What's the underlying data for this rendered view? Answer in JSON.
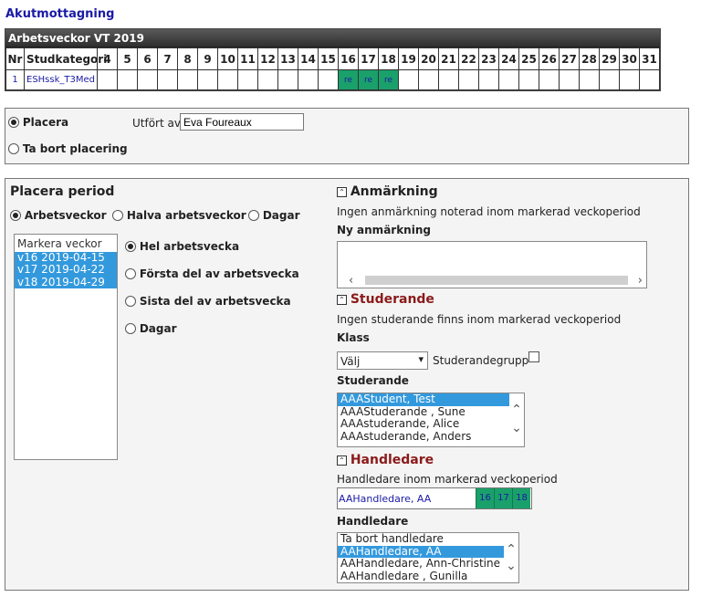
{
  "page": {
    "title": "Akutmottagning"
  },
  "weeks": {
    "header": "Arbetsveckor VT 2019",
    "col_nr": "Nr",
    "col_kat": "Studkategori",
    "week_numbers": [
      "4",
      "5",
      "6",
      "7",
      "8",
      "9",
      "10",
      "11",
      "12",
      "13",
      "14",
      "15",
      "16",
      "17",
      "18",
      "19",
      "20",
      "21",
      "22",
      "23",
      "24",
      "25",
      "26",
      "27",
      "28",
      "29",
      "30",
      "31"
    ],
    "row": {
      "nr": "1",
      "kat": "ESHssk_T3Med",
      "placed_weeks": [
        "16",
        "17",
        "18"
      ],
      "placed_label": "re"
    }
  },
  "placera": {
    "option_placera": "Placera",
    "option_ta_bort": "Ta bort placering",
    "utfort_label": "Utfört av",
    "utfort_value": "Eva Foureaux"
  },
  "period": {
    "title": "Placera period",
    "opt_arbetsveckor": "Arbetsveckor",
    "opt_halva": "Halva arbetsveckor",
    "opt_dagar": "Dagar",
    "markera_label": "Markera veckor",
    "weeks_list": [
      "v16 2019-04-15",
      "v17 2019-04-22",
      "v18 2019-04-29"
    ],
    "sub_hel": "Hel arbetsvecka",
    "sub_forsta": "Första del av arbetsvecka",
    "sub_sista": "Sista del av arbetsvecka",
    "sub_dagar": "Dagar"
  },
  "anmarkning": {
    "title": "Anmärkning",
    "info": "Ingen anmärkning noterad inom markerad veckoperiod",
    "new_label": "Ny anmärkning",
    "value": ""
  },
  "studerande": {
    "title": "Studerande",
    "info": "Ingen studerande finns inom markerad veckoperiod",
    "klass_label": "Klass",
    "klass_value": "Välj",
    "grupp_label": "Studerandegrupp",
    "list_label": "Studerande",
    "list": [
      "AAAStudent, Test",
      "AAAStuderande , Sune",
      "AAAstuderande, Alice",
      "AAAstuderande, Anders"
    ]
  },
  "handledare": {
    "title": "Handledare",
    "info": "Handledare inom markerad veckoperiod",
    "current_name": "AAHandledare, AA",
    "current_weeks": [
      "16",
      "17",
      "18"
    ],
    "list_label": "Handledare",
    "list": [
      "Ta bort handledare",
      "AAHandledare, AA",
      "AAHandledare, Ann-Christine",
      "AAHandledare , Gunilla"
    ]
  },
  "colors": {
    "accent_blue": "#1a1aa6",
    "placed_green": "#1aa06a",
    "selection": "#3399dd",
    "section_red": "#8b1a1a"
  }
}
